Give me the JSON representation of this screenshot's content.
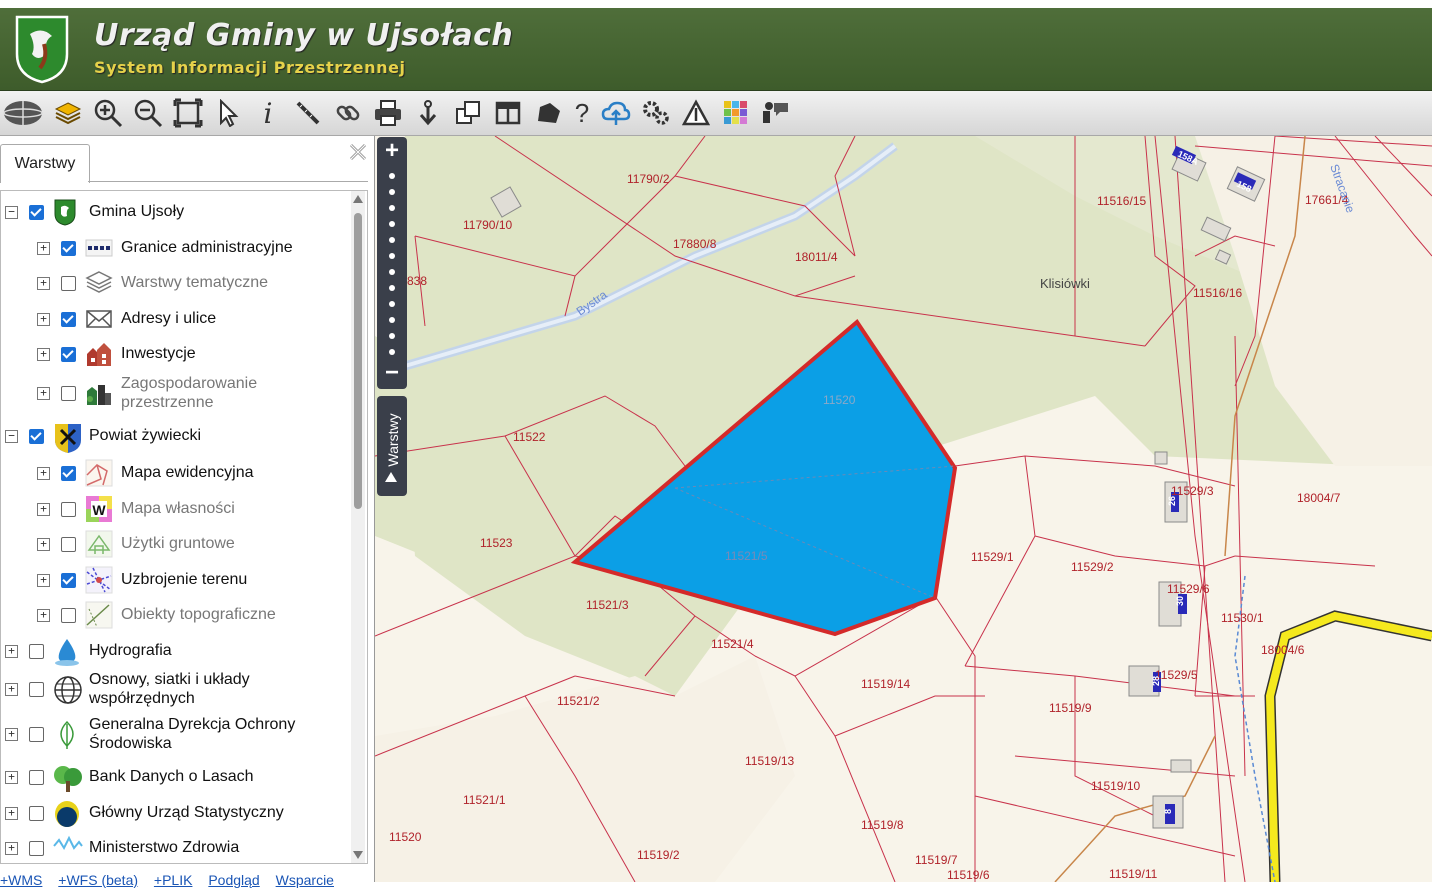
{
  "header": {
    "title": "Urząd Gminy w Ujsołach",
    "subtitle": "System Informacji Przestrzennej"
  },
  "toolbar": {
    "tools": [
      "geosystem-logo-icon",
      "layers-icon",
      "zoom-in-icon",
      "zoom-out-icon",
      "zoom-extent-icon",
      "select-arrow-icon",
      "info-icon",
      "measure-icon",
      "link-icon",
      "print-icon",
      "download-icon",
      "copy-icon",
      "layout-icon",
      "shape-icon",
      "help-icon",
      "cloud-upload-icon",
      "settings-icon",
      "warning-icon",
      "palette-icon",
      "chat-icon"
    ]
  },
  "panel": {
    "tab_label": "Warstwy",
    "layers": [
      {
        "label": "Gmina Ujsoły",
        "level": 0,
        "checked": true,
        "icon": "ujsoly-crest-icon",
        "expand": "−"
      },
      {
        "label": "Granice administracyjne",
        "level": 1,
        "checked": true,
        "icon": "boundary-line-icon",
        "expand": "+"
      },
      {
        "label": "Warstwy tematyczne",
        "level": 1,
        "checked": false,
        "icon": "stacked-layers-icon",
        "expand": "+"
      },
      {
        "label": "Adresy i ulice",
        "level": 1,
        "checked": true,
        "icon": "envelope-icon",
        "expand": "+"
      },
      {
        "label": "Inwestycje",
        "level": 1,
        "checked": true,
        "icon": "buildings-icon",
        "expand": "+"
      },
      {
        "label": "Zagospodarowanie przestrzenne",
        "level": 1,
        "checked": false,
        "icon": "city-plan-icon",
        "expand": "+",
        "multiline": true
      },
      {
        "label": "Powiat żywiecki",
        "level": 0,
        "checked": true,
        "icon": "powiat-crest-icon",
        "expand": "−"
      },
      {
        "label": "Mapa ewidencyjna",
        "level": 1,
        "checked": true,
        "icon": "cadastral-map-icon",
        "expand": "+"
      },
      {
        "label": "Mapa własności",
        "level": 1,
        "checked": false,
        "icon": "ownership-w-icon",
        "expand": "+"
      },
      {
        "label": "Użytki gruntowe",
        "level": 1,
        "checked": false,
        "icon": "land-use-icon",
        "expand": "+"
      },
      {
        "label": "Uzbrojenie terenu",
        "level": 1,
        "checked": true,
        "icon": "utilities-icon",
        "expand": "+"
      },
      {
        "label": "Obiekty topograficzne",
        "level": 1,
        "checked": false,
        "icon": "topography-icon",
        "expand": "+"
      },
      {
        "label": "Hydrografia",
        "level": 0,
        "checked": false,
        "icon": "water-drop-icon",
        "expand": "+"
      },
      {
        "label": "Osnowy, siatki i układy współrzędnych",
        "level": 0,
        "checked": false,
        "icon": "globe-grid-icon",
        "expand": "+",
        "multiline": true
      },
      {
        "label": "Generalna Dyrekcja Ochrony Środowiska",
        "level": 0,
        "checked": false,
        "icon": "leaf-icon",
        "expand": "+",
        "multiline": true
      },
      {
        "label": "Bank Danych o Lasach",
        "level": 0,
        "checked": false,
        "icon": "forest-icon",
        "expand": "+"
      },
      {
        "label": "Główny Urząd Statystyczny",
        "level": 0,
        "checked": false,
        "icon": "gus-logo-icon",
        "expand": "+"
      },
      {
        "label": "Ministerstwo Zdrowia",
        "level": 0,
        "checked": false,
        "icon": "health-wave-icon",
        "expand": "+"
      }
    ],
    "links": [
      "+WMS",
      "+WFS (beta)",
      "+PLIK",
      "Podgląd",
      "Wsparcie"
    ]
  },
  "map": {
    "zoom_in": "+",
    "zoom_out": "−",
    "side_tab": "Warstwy",
    "selected_parcel_color": "#0b9fe6",
    "selected_parcel_border": "#d42a2a",
    "parcel_line_color": "#c8324b",
    "labels": [
      "11790/2",
      "11790/10",
      "17880/8",
      "18011/4",
      "11516/15",
      "17661/4",
      "11516/16",
      "838",
      "Klisiówki",
      "Bystra",
      "11522",
      "11520",
      "11521/5",
      "11523",
      "11521/3",
      "11521/4",
      "11529/1",
      "11529/2",
      "11529/3",
      "18004/7",
      "11529/6",
      "11530/1",
      "18004/6",
      "11529/5",
      "11519/14",
      "11519/9",
      "11521/2",
      "11519/13",
      "11521/1",
      "11519/10",
      "11519/8",
      "11520",
      "11519/2",
      "11519/7",
      "11519/6",
      "11519/11",
      "158A",
      "158",
      "26",
      "30",
      "28",
      "8",
      "Stracanie"
    ]
  }
}
